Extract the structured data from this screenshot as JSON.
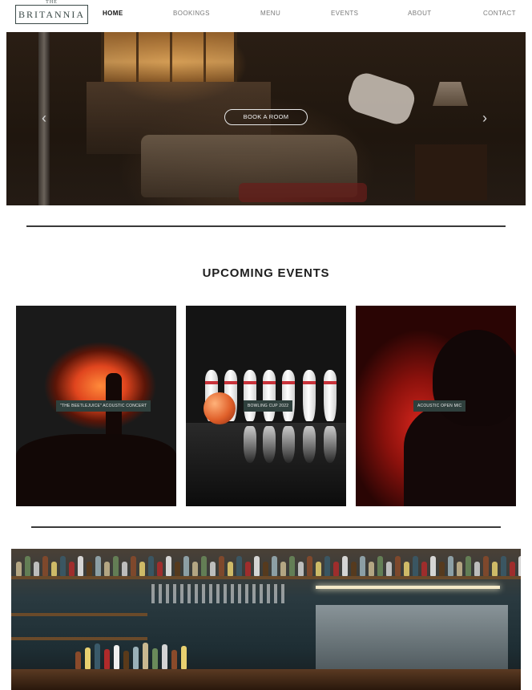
{
  "brand": {
    "small": "THE",
    "name": "BRITANNIA"
  },
  "nav": {
    "items": [
      {
        "label": "HOME",
        "active": true
      },
      {
        "label": "BOOKINGS",
        "active": false
      },
      {
        "label": "MENU",
        "active": false
      },
      {
        "label": "EVENTS",
        "active": false
      },
      {
        "label": "ABOUT",
        "active": false
      },
      {
        "label": "CONTACT",
        "active": false
      }
    ]
  },
  "hero": {
    "cta_label": "BOOK A ROOM",
    "prev_icon": "chevron-left-icon",
    "next_icon": "chevron-right-icon",
    "prev_glyph": "‹",
    "next_glyph": "›"
  },
  "events": {
    "title": "UPCOMING EVENTS",
    "items": [
      {
        "label": "\"THE BEETLEJUICE\" ACOUSTIC CONCERT"
      },
      {
        "label": "BOWLING CUP 2022"
      },
      {
        "label": "ACOUSTIC OPEN MIC"
      }
    ]
  },
  "colors": {
    "label_bg": "#2f403d",
    "divider": "#3a3a3a",
    "logo": "#3b4a48"
  }
}
